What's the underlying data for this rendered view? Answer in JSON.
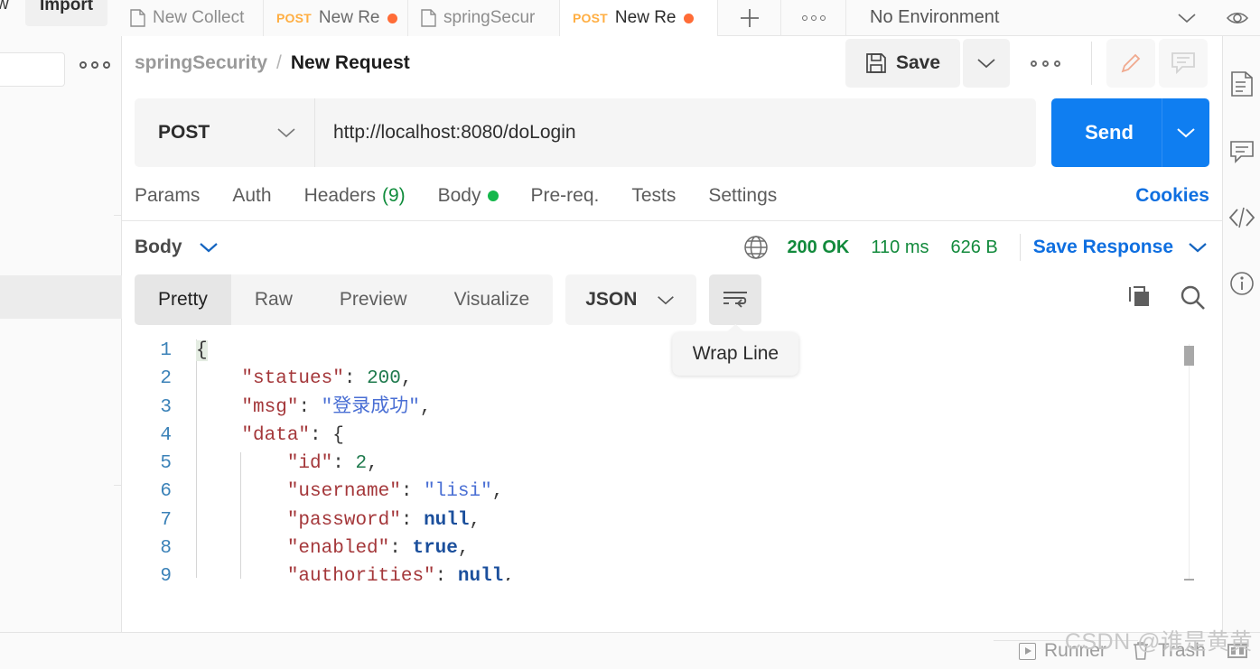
{
  "topbar": {
    "view_label": "w",
    "import_label": "Import",
    "tabs": [
      {
        "icon": "collection-doc-icon",
        "method": "",
        "label": "New Collect",
        "unsaved": false,
        "active": false
      },
      {
        "icon": "",
        "method": "POST",
        "label": "New Re",
        "unsaved": true,
        "active": false
      },
      {
        "icon": "collection-doc-icon",
        "method": "",
        "label": "springSecur",
        "unsaved": false,
        "active": false
      },
      {
        "icon": "",
        "method": "POST",
        "label": "New Re",
        "unsaved": true,
        "active": true
      }
    ],
    "new_tab_glyph": "+",
    "tab_options_icon": "more-horizontal-icon",
    "environment": "No Environment",
    "environment_caret": "chevron-down-icon",
    "eye_icon": "eye-icon"
  },
  "rail": {
    "items": [
      {
        "icon": "documentation-icon"
      },
      {
        "icon": "comment-icon"
      },
      {
        "icon": "code-snippet-icon"
      },
      {
        "icon": "info-circle-icon"
      }
    ]
  },
  "leftpanel": {
    "options_icon": "more-horizontal-icon"
  },
  "header": {
    "collection": "springSecurity",
    "separator": "/",
    "request_name": "New Request",
    "save_label": "Save",
    "save_icon": "floppy-disk-icon",
    "save_caret": "chevron-down-icon",
    "more_icon": "more-horizontal-icon",
    "edit_icon": "pencil-icon",
    "comment_icon": "comment-icon"
  },
  "request": {
    "method": "POST",
    "method_caret": "chevron-down-icon",
    "url": "http://localhost:8080/doLogin",
    "send_label": "Send",
    "send_caret": "chevron-down-icon",
    "tabs": [
      {
        "label": "Params",
        "badge": "",
        "dot": false
      },
      {
        "label": "Auth",
        "badge": "",
        "dot": false
      },
      {
        "label": "Headers",
        "badge": "(9)",
        "dot": false
      },
      {
        "label": "Body",
        "badge": "",
        "dot": true
      },
      {
        "label": "Pre-req.",
        "badge": "",
        "dot": false
      },
      {
        "label": "Tests",
        "badge": "",
        "dot": false
      },
      {
        "label": "Settings",
        "badge": "",
        "dot": false
      }
    ],
    "cookies_label": "Cookies"
  },
  "response": {
    "body_label": "Body",
    "body_caret": "chevron-down-icon",
    "globe_icon": "globe-icon",
    "status": "200 OK",
    "time": "110 ms",
    "size": "626 B",
    "save_response_label": "Save Response",
    "save_response_caret": "chevron-down-icon",
    "view_tabs": [
      {
        "label": "Pretty",
        "active": true
      },
      {
        "label": "Raw",
        "active": false
      },
      {
        "label": "Preview",
        "active": false
      },
      {
        "label": "Visualize",
        "active": false
      }
    ],
    "format": "JSON",
    "format_caret": "chevron-down-icon",
    "wrap_icon": "wrap-line-icon",
    "wrap_tooltip": "Wrap Line",
    "copy_icon": "copy-icon",
    "search_icon": "search-icon",
    "line_numbers": [
      "1",
      "2",
      "3",
      "4",
      "5",
      "6",
      "7",
      "8",
      "9"
    ],
    "json_lines": [
      {
        "indent": 0,
        "tokens": [
          {
            "t": "{",
            "c": "hl-brace"
          }
        ]
      },
      {
        "indent": 1,
        "tokens": [
          {
            "t": "\"statues\"",
            "c": "k"
          },
          {
            "t": ": ",
            "c": "pn"
          },
          {
            "t": "200",
            "c": "num"
          },
          {
            "t": ",",
            "c": "pn"
          }
        ]
      },
      {
        "indent": 1,
        "tokens": [
          {
            "t": "\"msg\"",
            "c": "k"
          },
          {
            "t": ": ",
            "c": "pn"
          },
          {
            "t": "\"登录成功\"",
            "c": "str"
          },
          {
            "t": ",",
            "c": "pn"
          }
        ]
      },
      {
        "indent": 1,
        "tokens": [
          {
            "t": "\"data\"",
            "c": "k"
          },
          {
            "t": ": ",
            "c": "pn"
          },
          {
            "t": "{",
            "c": "pn"
          }
        ]
      },
      {
        "indent": 2,
        "tokens": [
          {
            "t": "\"id\"",
            "c": "k"
          },
          {
            "t": ": ",
            "c": "pn"
          },
          {
            "t": "2",
            "c": "num"
          },
          {
            "t": ",",
            "c": "pn"
          }
        ]
      },
      {
        "indent": 2,
        "tokens": [
          {
            "t": "\"username\"",
            "c": "k"
          },
          {
            "t": ": ",
            "c": "pn"
          },
          {
            "t": "\"lisi\"",
            "c": "str"
          },
          {
            "t": ",",
            "c": "pn"
          }
        ]
      },
      {
        "indent": 2,
        "tokens": [
          {
            "t": "\"password\"",
            "c": "k"
          },
          {
            "t": ": ",
            "c": "pn"
          },
          {
            "t": "null",
            "c": "lit"
          },
          {
            "t": ",",
            "c": "pn"
          }
        ]
      },
      {
        "indent": 2,
        "tokens": [
          {
            "t": "\"enabled\"",
            "c": "k"
          },
          {
            "t": ": ",
            "c": "pn"
          },
          {
            "t": "true",
            "c": "lit"
          },
          {
            "t": ",",
            "c": "pn"
          }
        ]
      },
      {
        "indent": 2,
        "tokens": [
          {
            "t": "\"authorities\"",
            "c": "k"
          },
          {
            "t": ": ",
            "c": "pn"
          },
          {
            "t": "null",
            "c": "lit"
          },
          {
            "t": ",",
            "c": "pn"
          }
        ]
      }
    ]
  },
  "bottombar": {
    "runner_label": "Runner",
    "trash_label": "Trash",
    "runner_icon": "play-box-icon",
    "trash_icon": "trash-icon",
    "layout_icon": "two-pane-icon"
  },
  "watermark": "CSDN @谁是黄黄",
  "colors": {
    "accent_blue": "#0f7ef1",
    "link_blue": "#0f6fe0",
    "status_green": "#128a3c",
    "method_orange": "#ffae42",
    "unsaved_orange": "#ff6c37"
  }
}
